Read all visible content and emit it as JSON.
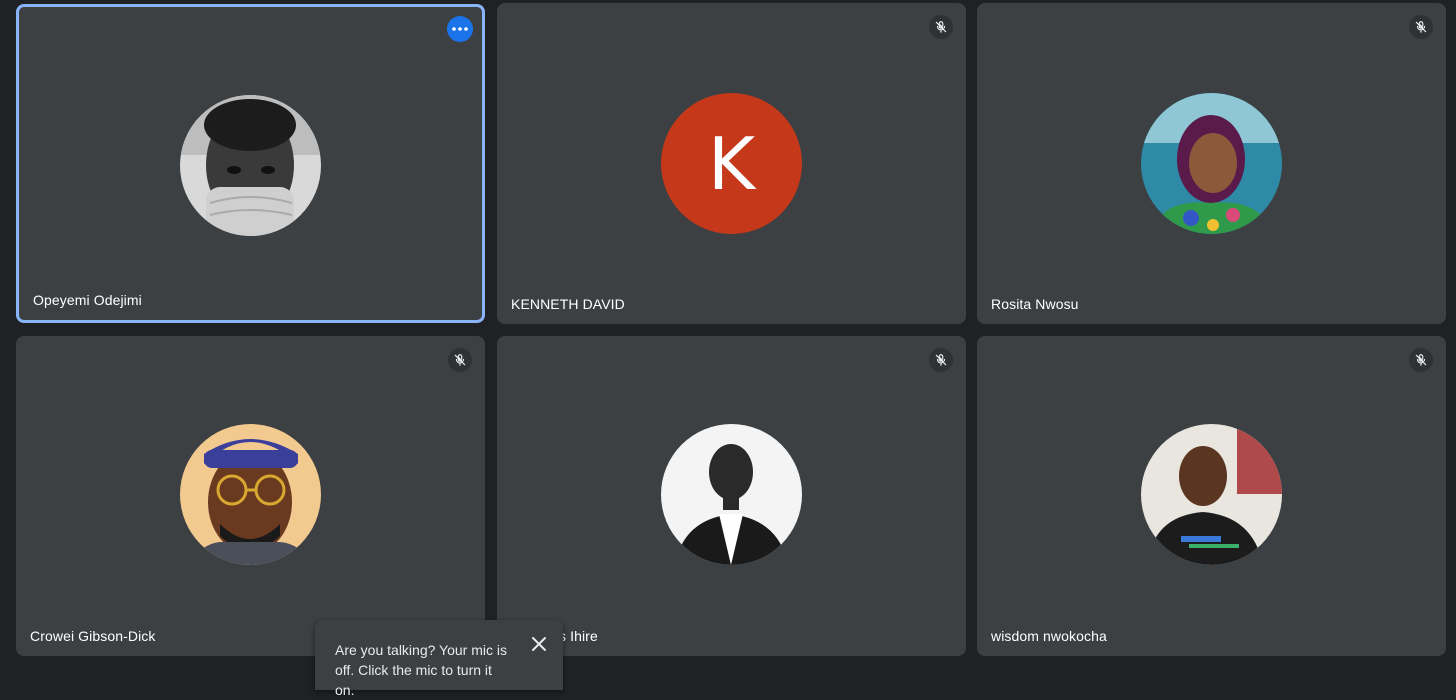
{
  "participants": [
    {
      "name": "Opeyemi Odejimi",
      "avatar_icon": "user-photo-icon",
      "active": true,
      "has_more_button": true
    },
    {
      "name": "KENNETH DAVID",
      "avatar_letter": "K",
      "avatar_color": "#c5381a",
      "muted": true
    },
    {
      "name": "Rosita Nwosu",
      "avatar_icon": "user-photo-icon",
      "muted": true
    },
    {
      "name": "Crowei Gibson-Dick",
      "avatar_icon": "user-photo-icon",
      "muted": true
    },
    {
      "name": "s Ihire",
      "avatar_icon": "user-photo-icon",
      "muted": true
    },
    {
      "name": "wisdom nwokocha",
      "avatar_icon": "user-photo-icon",
      "muted": true
    }
  ],
  "toast": {
    "message": "Are you talking? Your mic is off. Click the mic to turn it on."
  },
  "colors": {
    "background": "#202124",
    "tile": "#3c4043",
    "active_border": "#8ab4f8",
    "accent": "#1a73e8"
  }
}
